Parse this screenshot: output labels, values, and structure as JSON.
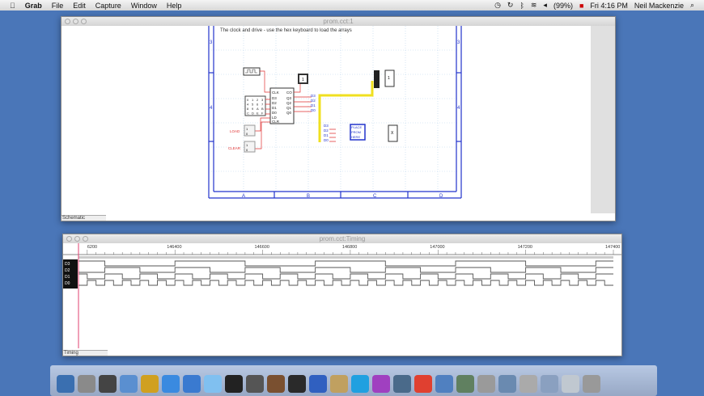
{
  "menubar": {
    "apple": "",
    "app": "Grab",
    "items": [
      "File",
      "Edit",
      "Capture",
      "Window",
      "Help"
    ],
    "battery": "(99%)",
    "clock": "Fri 4:16 PM",
    "user": "Neil Mackenzie"
  },
  "schematic_window": {
    "title": "prom.cct:1",
    "status": "Schematic",
    "hint": "The clock and drive - use the hex keyboard to load the arrays",
    "row_labels": [
      "3",
      "4"
    ],
    "col_labels": [
      "A",
      "B",
      "C",
      "D"
    ],
    "pins_in": [
      "CLK",
      "D3",
      "D2",
      "D1",
      "D0",
      "LD",
      "CLR"
    ],
    "pins_out": [
      "CO",
      "Q3",
      "Q2",
      "Q1",
      "Q0"
    ],
    "keypad": [
      "0",
      "1",
      "2",
      "3",
      "4",
      "5",
      "6",
      "7",
      "8",
      "9",
      "A",
      "B",
      "C",
      "D",
      "E",
      "F"
    ],
    "switch_labels": [
      "LOAD",
      "CLEAR"
    ],
    "switch_values": [
      "1",
      "0"
    ],
    "bus_labels": [
      "D3",
      "D2",
      "D1",
      "D0"
    ],
    "prom_label": [
      "PLACE",
      "PROM",
      "HERE"
    ],
    "display1": "1",
    "display2": "X",
    "const": "1"
  },
  "timing_window": {
    "title": "prom.cct:Timing",
    "status": "Timing",
    "ticks": [
      "6200",
      "146400",
      "146600",
      "146800",
      "147000",
      "147200",
      "147400"
    ],
    "signals": [
      {
        "name": "D3",
        "period": 320,
        "phase": 0
      },
      {
        "name": "D2",
        "period": 160,
        "phase": 80
      },
      {
        "name": "D1",
        "period": 80,
        "phase": 40
      },
      {
        "name": "D0",
        "period": 40,
        "phase": 20
      }
    ]
  }
}
